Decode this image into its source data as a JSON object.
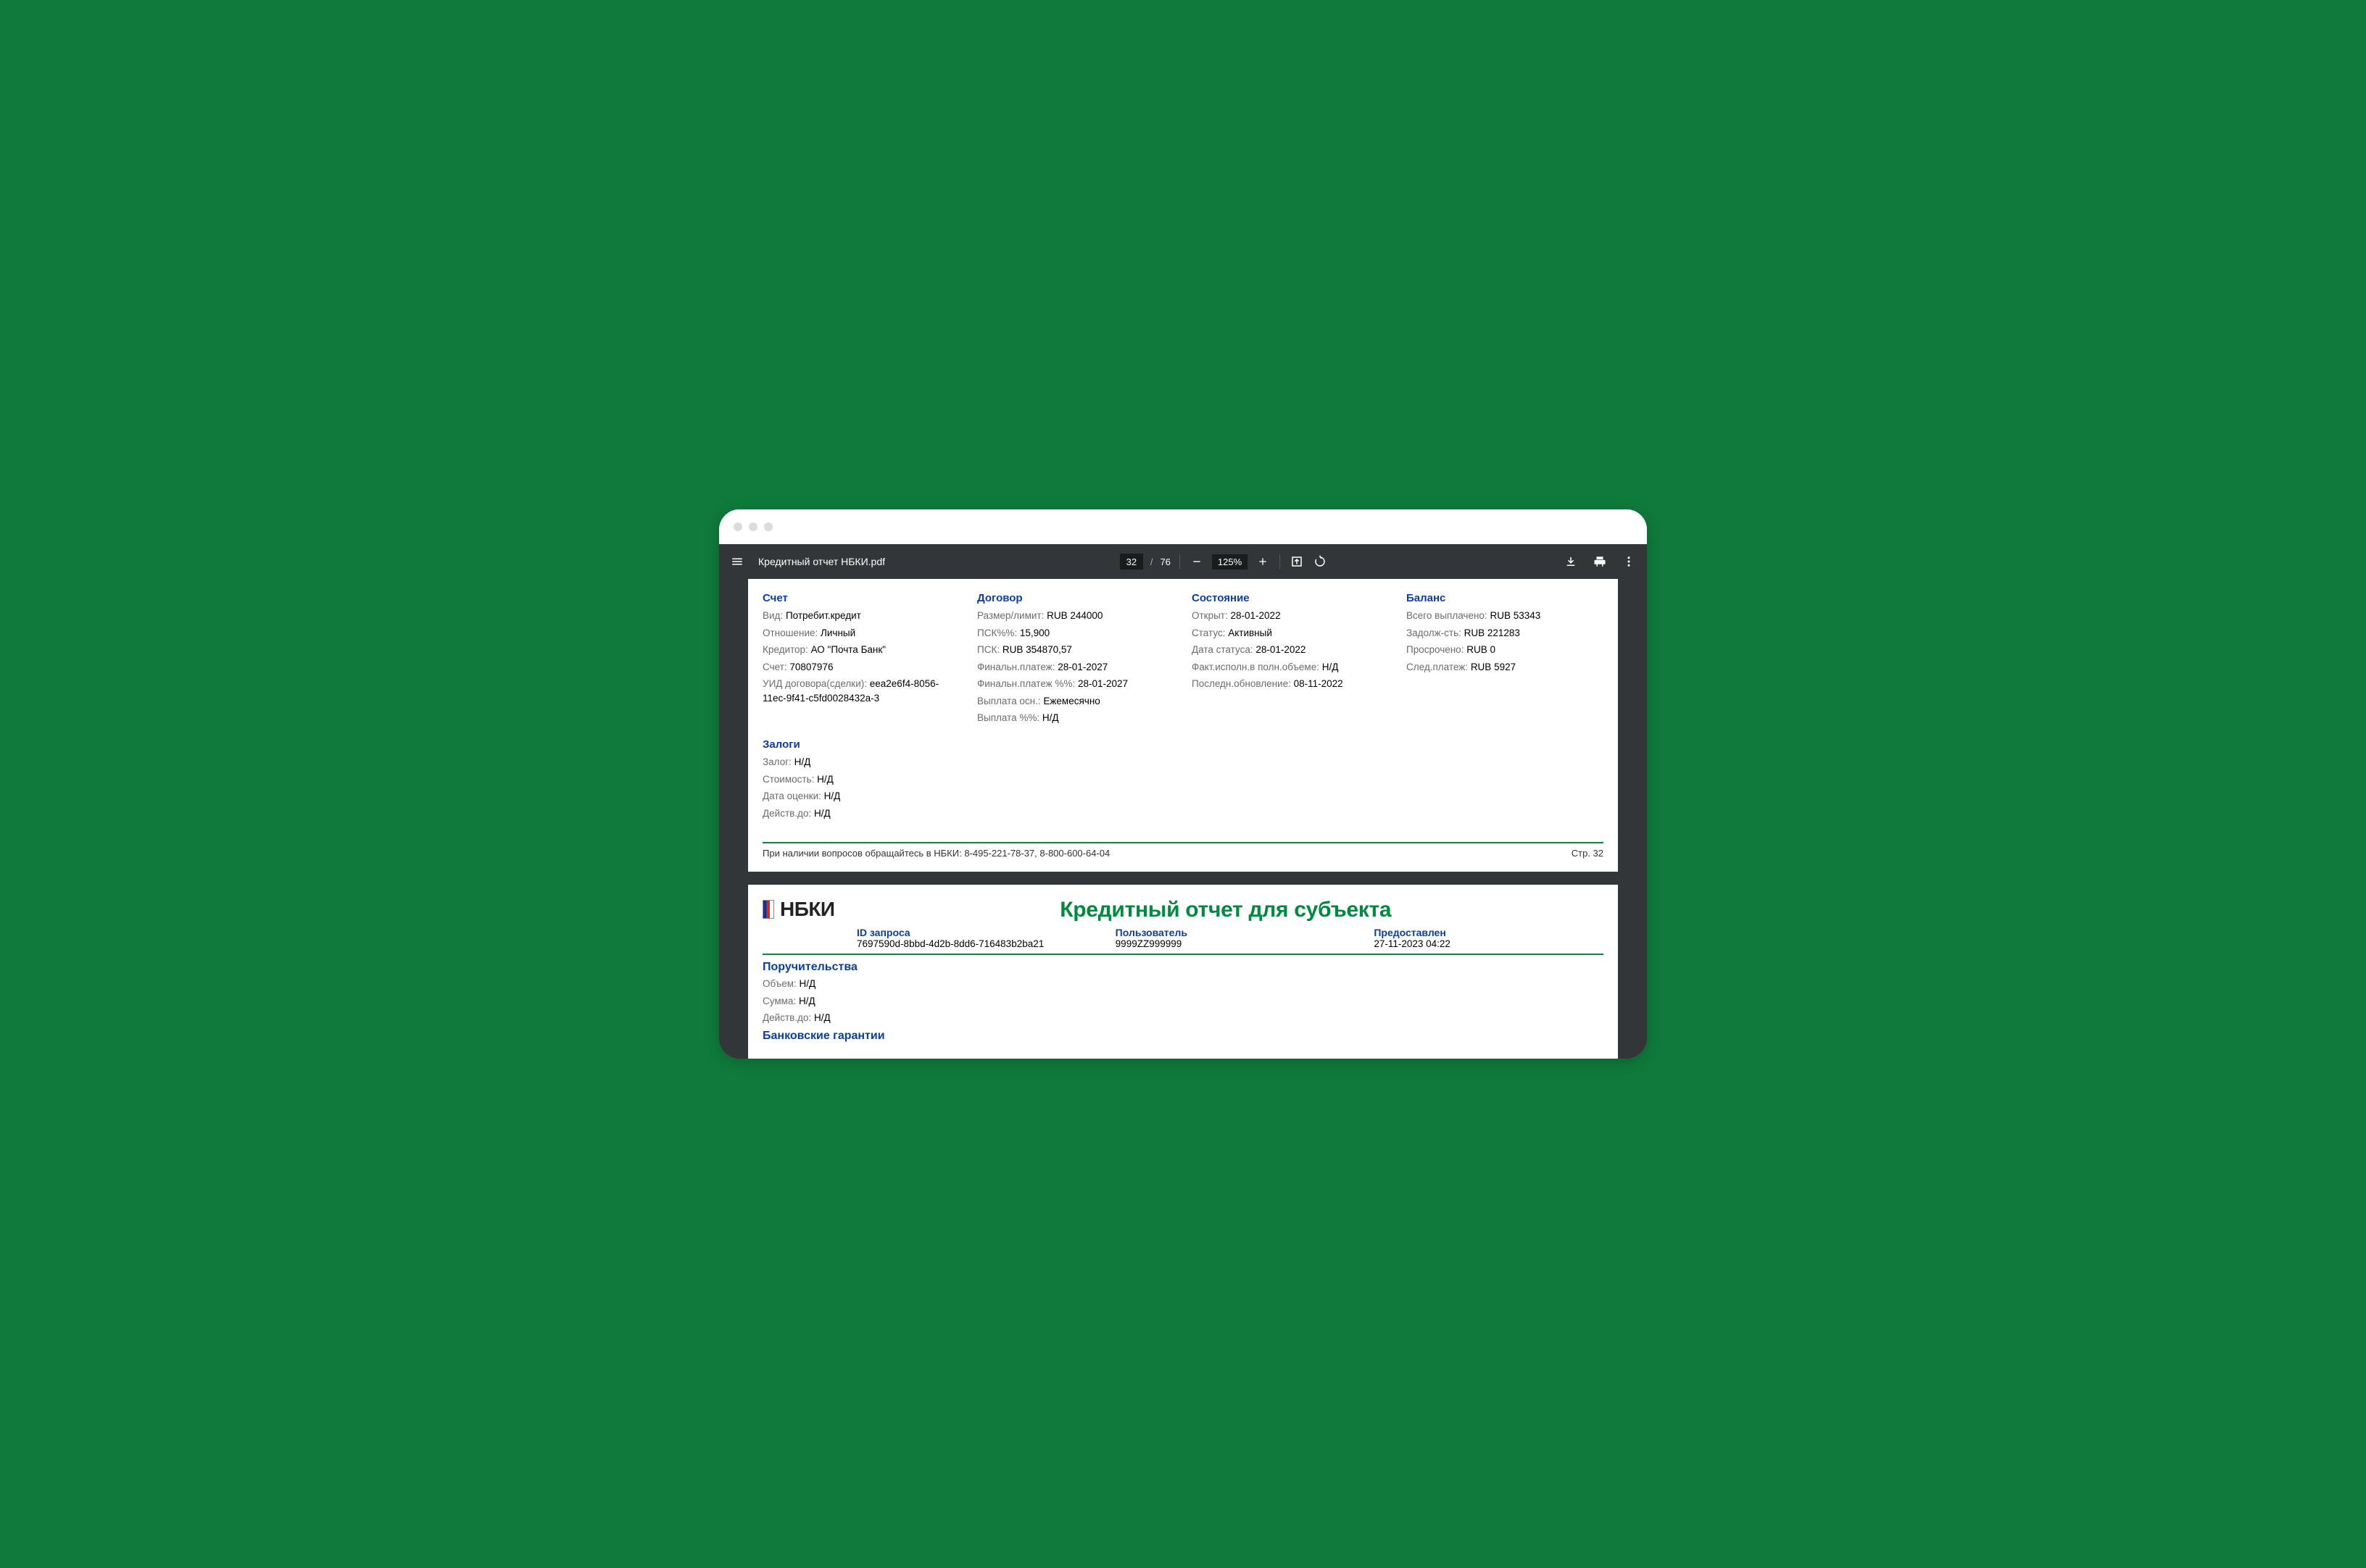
{
  "toolbar": {
    "filename": "Кредитный отчет НБКИ.pdf",
    "page_current": "32",
    "page_total": "76",
    "zoom": "125%"
  },
  "page1": {
    "account": {
      "title": "Счет",
      "type_label": "Вид:",
      "type_value": "Потребит.кредит",
      "relation_label": "Отношение:",
      "relation_value": "Личный",
      "creditor_label": "Кредитор:",
      "creditor_value": "АО \"Почта Банк\"",
      "account_label": "Счет:",
      "account_value": "70807976",
      "uid_label": "УИД договора(сделки):",
      "uid_value": "eea2e6f4-8056-11ec-9f41-c5fd0028432a-3"
    },
    "contract": {
      "title": "Договор",
      "limit_label": "Размер/лимит:",
      "limit_value": "RUB 244000",
      "pskpct_label": "ПСК%%:",
      "pskpct_value": "15,900",
      "psk_label": "ПСК:",
      "psk_value": "RUB 354870,57",
      "final_label": "Финальн.платеж:",
      "final_value": "28-01-2027",
      "finalpct_label": "Финальн.платеж %%:",
      "finalpct_value": "28-01-2027",
      "payout_label": "Выплата осн.:",
      "payout_value": "Ежемесячно",
      "payoutpct_label": "Выплата %%:",
      "payoutpct_value": "Н/Д"
    },
    "status": {
      "title": "Состояние",
      "opened_label": "Открыт:",
      "opened_value": "28-01-2022",
      "status_label": "Статус:",
      "status_value": "Активный",
      "status_date_label": "Дата статуса:",
      "status_date_value": "28-01-2022",
      "fact_label": "Факт.исполн.в полн.объеме:",
      "fact_value": "Н/Д",
      "updated_label": "Последн.обновление:",
      "updated_value": "08-11-2022"
    },
    "balance": {
      "title": "Баланс",
      "paid_label": "Всего выплачено:",
      "paid_value": "RUB 53343",
      "debt_label": "Задолж-сть:",
      "debt_value": "RUB 221283",
      "overdue_label": "Просрочено:",
      "overdue_value": "RUB 0",
      "next_label": "След.платеж:",
      "next_value": "RUB 5927"
    },
    "pledges": {
      "title": "Залоги",
      "pledge_label": "Залог:",
      "pledge_value": "Н/Д",
      "cost_label": "Стоимость:",
      "cost_value": "Н/Д",
      "eval_label": "Дата оценки:",
      "eval_value": "Н/Д",
      "valid_label": "Действ.до:",
      "valid_value": "Н/Д"
    },
    "footer_left": "При наличии вопросов обращайтесь в НБКИ: 8-495-221-78-37, 8-800-600-64-04",
    "footer_right": "Стр. 32"
  },
  "page2": {
    "logo": "НБКИ",
    "title": "Кредитный отчет для субъекта",
    "meta": {
      "req_label": "ID запроса",
      "req_value": "7697590d-8bbd-4d2b-8dd6-716483b2ba21",
      "user_label": "Пользователь",
      "user_value": "9999ZZ999999",
      "date_label": "Предоставлен",
      "date_value": "27-11-2023 04:22"
    },
    "surety": {
      "title": "Поручительства",
      "vol_label": "Объем:",
      "vol_value": "Н/Д",
      "sum_label": "Сумма:",
      "sum_value": "Н/Д",
      "valid_label": "Действ.до:",
      "valid_value": "Н/Д"
    },
    "bank_guarantees_title": "Банковские гарантии"
  }
}
